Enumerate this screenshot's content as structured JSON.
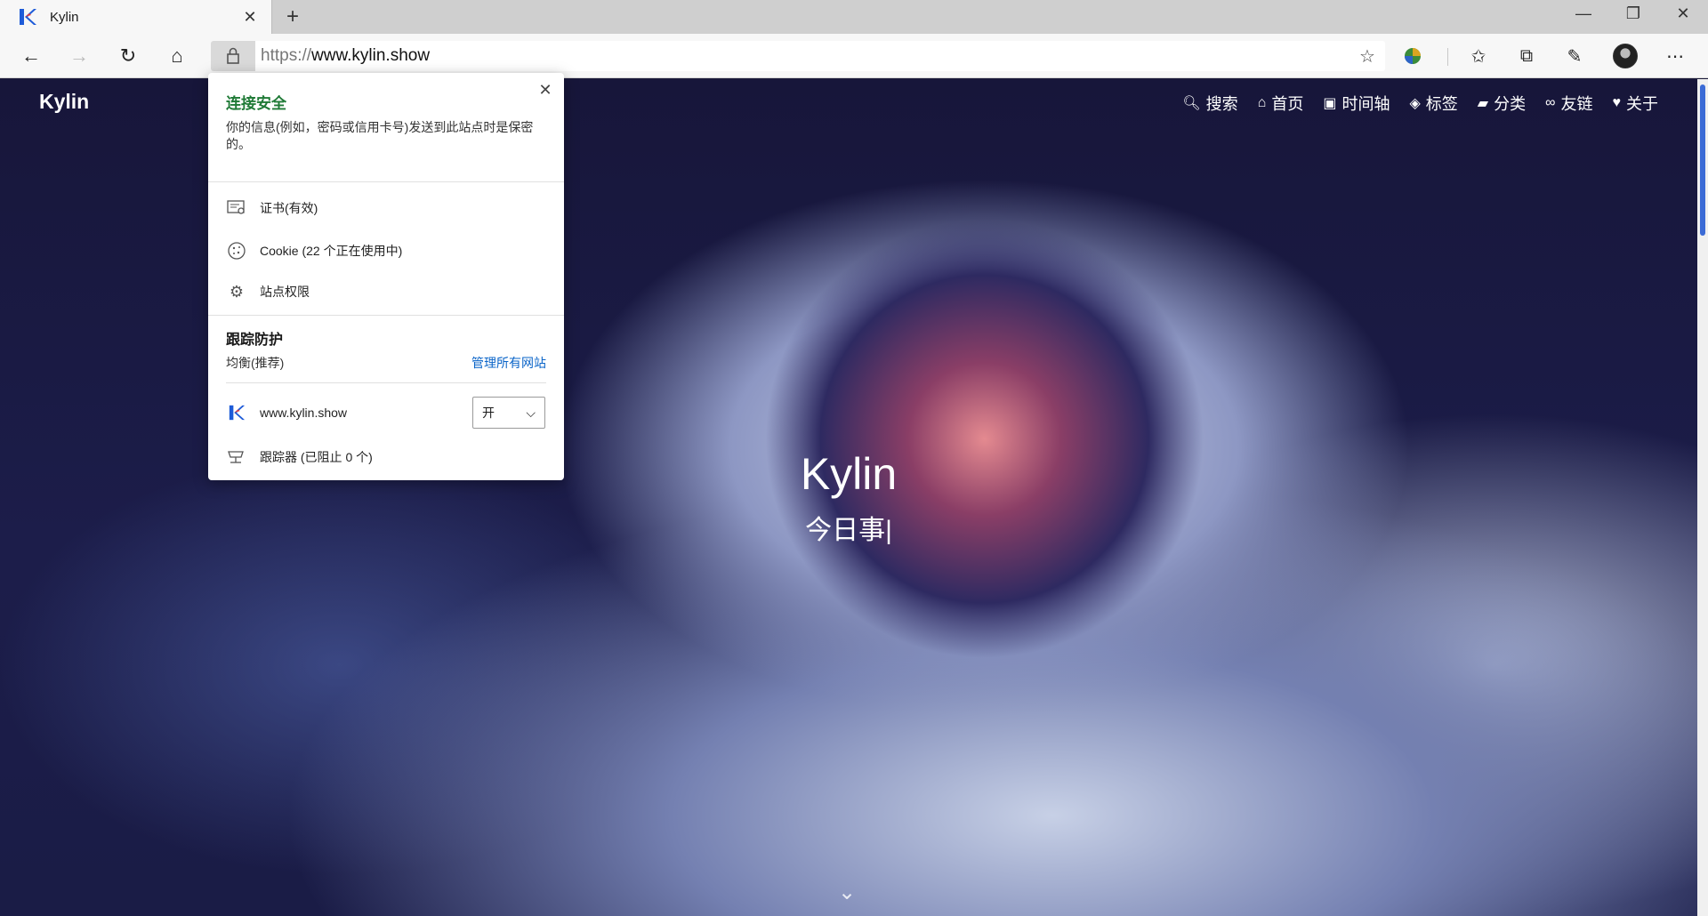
{
  "tab": {
    "title": "Kylin",
    "close": "✕",
    "new_tab": "+"
  },
  "window": {
    "minimize": "—",
    "restore": "❐",
    "close": "✕"
  },
  "address_bar": {
    "protocol": "https://",
    "host": "www.kylin.show"
  },
  "site": {
    "logo": "Kylin",
    "menu": [
      {
        "icon": "search-icon",
        "label": "搜索"
      },
      {
        "icon": "home-icon",
        "label": "首页"
      },
      {
        "icon": "archive-icon",
        "label": "时间轴"
      },
      {
        "icon": "tags-icon",
        "label": "标签"
      },
      {
        "icon": "folder-icon",
        "label": "分类"
      },
      {
        "icon": "link-icon",
        "label": "友链"
      },
      {
        "icon": "heart-icon",
        "label": "关于"
      }
    ],
    "hero_title": "Kylin",
    "hero_subtitle": "今日事|"
  },
  "security_popup": {
    "title": "连接安全",
    "description": "你的信息(例如，密码或信用卡号)发送到此站点时是保密的。",
    "certificate": "证书(有效)",
    "cookies": "Cookie (22 个正在使用中)",
    "permissions": "站点权限",
    "tracking_title": "跟踪防护",
    "tracking_level": "均衡(推荐)",
    "manage_link": "管理所有网站",
    "site_host": "www.kylin.show",
    "toggle_value": "开",
    "trackers": "跟踪器 (已阻止 0 个)"
  },
  "colors": {
    "secure_green": "#1f7a36",
    "link_blue": "#0a64c8",
    "accent_blue": "#3b6bd6"
  }
}
